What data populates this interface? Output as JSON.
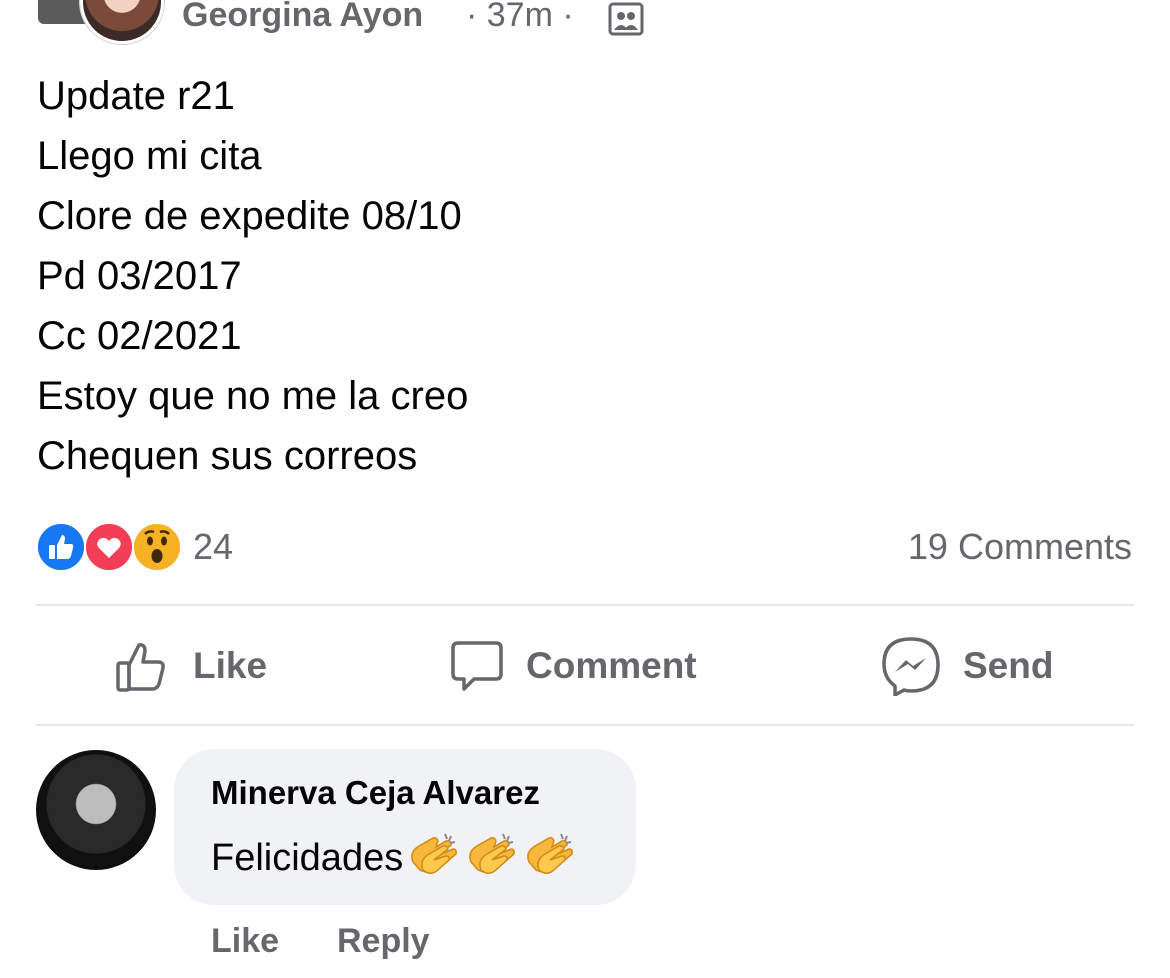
{
  "post": {
    "author": "Georgina Ayon",
    "meta": "· 37m ·",
    "privacy_icon": "group-icon",
    "body": [
      "Update r21",
      "Llego mi cita",
      "Clore de expedite 08/10",
      "Pd 03/2017",
      "Cc 02/2021",
      "Estoy que no me la creo",
      "Chequen sus correos"
    ],
    "reaction_count": "24",
    "reactions": [
      "like-icon",
      "love-icon",
      "wow-icon"
    ],
    "comments_label": "19 Comments"
  },
  "actions": {
    "like": "Like",
    "comment": "Comment",
    "send": "Send"
  },
  "comment": {
    "author": "Minerva Ceja Alvarez",
    "text": "Felicidades",
    "emoji": "clapping-hands-icon",
    "like": "Like",
    "reply": "Reply"
  },
  "colors": {
    "secondary_text": "#65676b",
    "like_blue": "#1877f2",
    "love_red": "#f33e58",
    "wow_yellow": "#f7b125",
    "bubble_bg": "#f0f2f5"
  }
}
